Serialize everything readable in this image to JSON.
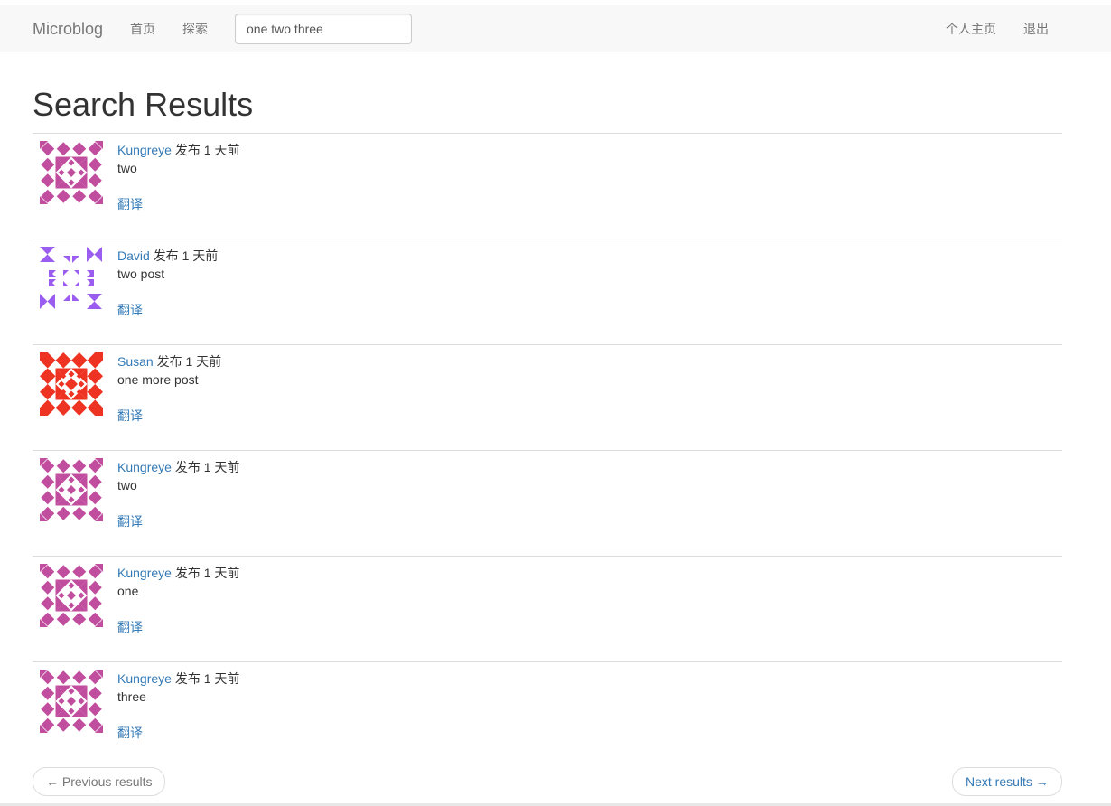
{
  "navbar": {
    "brand": "Microblog",
    "home": "首页",
    "explore": "探索",
    "search_value": "one two three",
    "profile": "个人主页",
    "logout": "退出"
  },
  "page_title": "Search Results",
  "posts": [
    {
      "author": "Kungreye",
      "meta": "发布 1 天前",
      "body": "two",
      "translate": "翻译",
      "avatar_color": "#c04d9e",
      "avatar_style": "lattice"
    },
    {
      "author": "David",
      "meta": "发布 1 天前",
      "body": "two post",
      "translate": "翻译",
      "avatar_color": "#9b5cf0",
      "avatar_style": "frame"
    },
    {
      "author": "Susan",
      "meta": "发布 1 天前",
      "body": "one more post",
      "translate": "翻译",
      "avatar_color": "#ee3322",
      "avatar_style": "lattice-dense"
    },
    {
      "author": "Kungreye",
      "meta": "发布 1 天前",
      "body": "two",
      "translate": "翻译",
      "avatar_color": "#c04d9e",
      "avatar_style": "lattice"
    },
    {
      "author": "Kungreye",
      "meta": "发布 1 天前",
      "body": "one",
      "translate": "翻译",
      "avatar_color": "#c04d9e",
      "avatar_style": "lattice"
    },
    {
      "author": "Kungreye",
      "meta": "发布 1 天前",
      "body": "three",
      "translate": "翻译",
      "avatar_color": "#c04d9e",
      "avatar_style": "lattice"
    }
  ],
  "pager": {
    "prev": "← Previous results",
    "next": "Next results →"
  }
}
